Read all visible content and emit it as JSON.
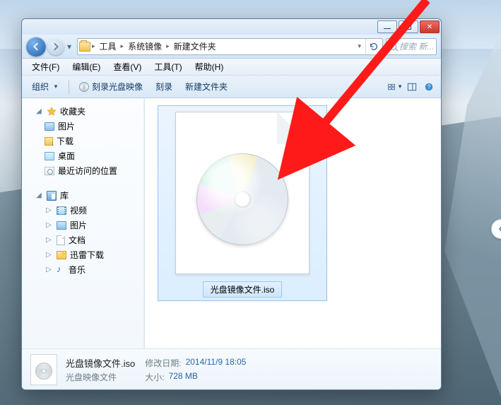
{
  "window": {
    "caption": {
      "minimize": "min",
      "maximize": "max",
      "close": "close"
    },
    "breadcrumb": [
      "工具",
      "系统镜像",
      "新建文件夹"
    ],
    "search_placeholder": "搜索 新..."
  },
  "menu": {
    "file": "文件(F)",
    "edit": "编辑(E)",
    "view": "查看(V)",
    "tools": "工具(T)",
    "help": "帮助(H)"
  },
  "toolbar": {
    "organize": "组织",
    "burn_image": "刻录光盘映像",
    "burn": "刻录",
    "new_folder": "新建文件夹"
  },
  "sidebar": {
    "favorites": "收藏夹",
    "fav_items": {
      "pictures": "图片",
      "downloads": "下载",
      "desktop": "桌面",
      "recent": "最近访问的位置"
    },
    "libraries": "库",
    "lib_items": {
      "videos": "视频",
      "pictures": "图片",
      "documents": "文档",
      "thunder": "迅雷下载",
      "music": "音乐"
    }
  },
  "content": {
    "selected_file": "光盘镜像文件.iso"
  },
  "details": {
    "filename": "光盘镜像文件.iso",
    "filetype": "光盘映像文件",
    "modified_label": "修改日期:",
    "modified_value": "2014/11/9 18:05",
    "size_label": "大小:",
    "size_value": "728 MB"
  }
}
